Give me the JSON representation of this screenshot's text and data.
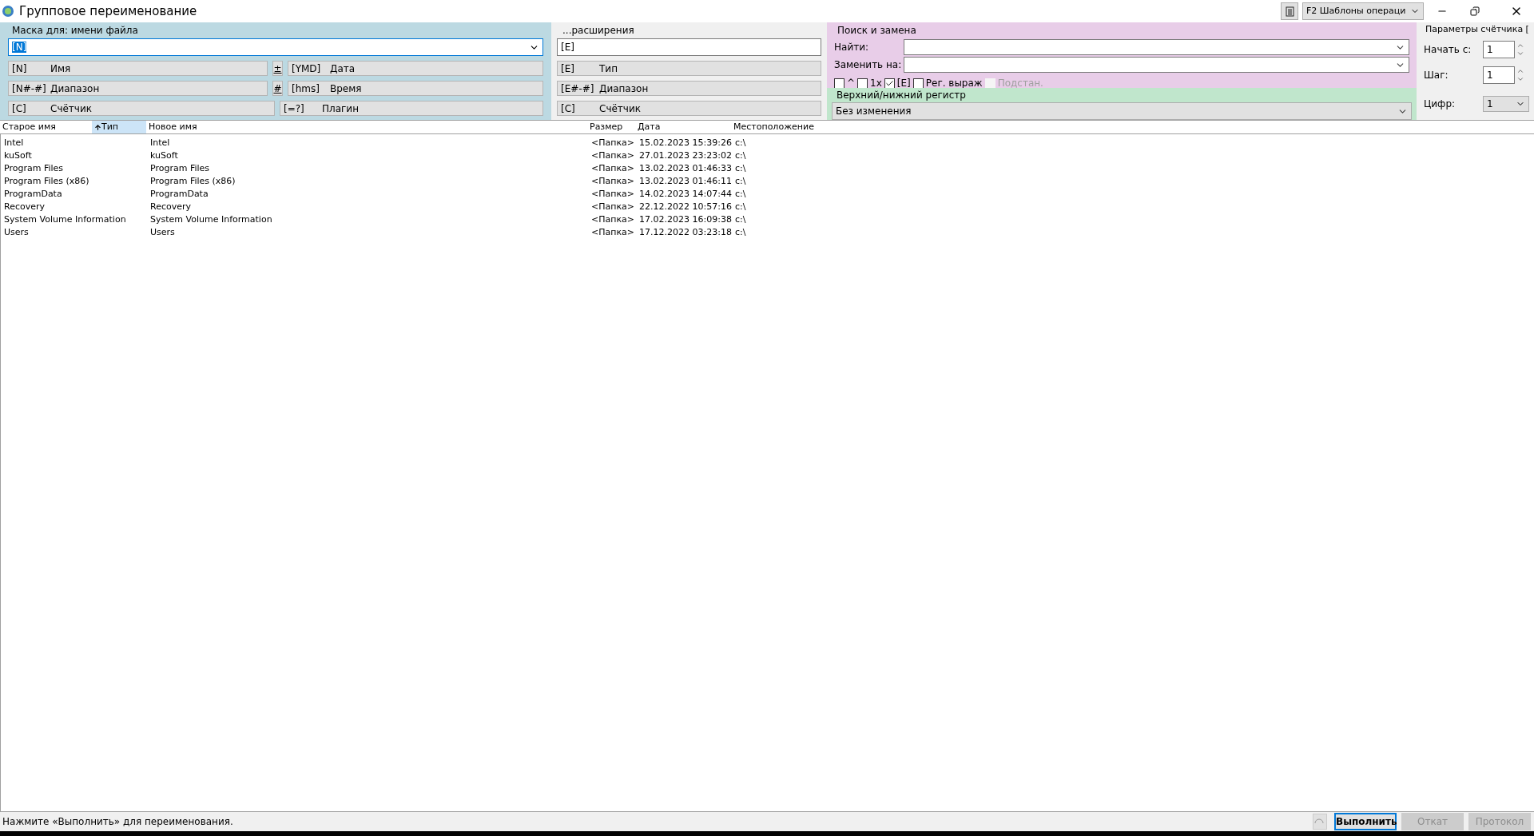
{
  "window": {
    "title": "Групповое переименование",
    "template_button": "F2 Шаблоны операци"
  },
  "mask": {
    "label": "Маска для: имени файла",
    "value": "[N]",
    "buttons": [
      {
        "code": "[N]",
        "label": "Имя",
        "side": "±",
        "code2": "[YMD]",
        "label2": "Дата"
      },
      {
        "code": "[N#-#]",
        "label": "Диапазон",
        "side": "#",
        "code2": "[hms]",
        "label2": "Время"
      },
      {
        "code": "[C]",
        "label": "Счётчик",
        "code2": "[=?]",
        "label2": "Плагин"
      }
    ]
  },
  "extension": {
    "label": "...расширения",
    "value": "[E]",
    "buttons": [
      {
        "code": "[E]",
        "label": "Тип"
      },
      {
        "code": "[E#-#]",
        "label": "Диапазон"
      },
      {
        "code": "[C]",
        "label": "Счётчик"
      }
    ]
  },
  "search_replace": {
    "label": "Поиск и замена",
    "find_label": "Найти:",
    "replace_label": "Заменить на:",
    "options": [
      {
        "label": "^",
        "checked": false,
        "disabled": false
      },
      {
        "label": "1x",
        "checked": false,
        "disabled": false
      },
      {
        "label": "[E]",
        "checked": true,
        "disabled": false
      },
      {
        "label": "Рег. выраж",
        "checked": false,
        "disabled": false
      },
      {
        "label": "Подстан.",
        "checked": false,
        "disabled": true
      }
    ]
  },
  "case": {
    "label": "Верхний/нижний регистр",
    "value": "Без изменения"
  },
  "counter": {
    "label": "Параметры счётчика [",
    "start_label": "Начать с:",
    "start": "1",
    "step_label": "Шаг:",
    "step": "1",
    "digits_label": "Цифр:",
    "digits": "1"
  },
  "table": {
    "columns": [
      {
        "label": "Старое имя",
        "sorted": false
      },
      {
        "label": "Тип",
        "sorted": true
      },
      {
        "label": "Новое имя",
        "sorted": false
      },
      {
        "label": "Размер",
        "sorted": false
      },
      {
        "label": "Дата",
        "sorted": false
      },
      {
        "label": "Местоположение",
        "sorted": false
      }
    ],
    "rows": [
      [
        "Intel",
        "",
        "Intel",
        "<Папка>",
        "15.02.2023 15:39:26",
        "c:\\"
      ],
      [
        "kuSoft",
        "",
        "kuSoft",
        "<Папка>",
        "27.01.2023 23:23:02",
        "c:\\"
      ],
      [
        "Program Files",
        "",
        "Program Files",
        "<Папка>",
        "13.02.2023 01:46:33",
        "c:\\"
      ],
      [
        "Program Files (x86)",
        "",
        "Program Files (x86)",
        "<Папка>",
        "13.02.2023 01:46:11",
        "c:\\"
      ],
      [
        "ProgramData",
        "",
        "ProgramData",
        "<Папка>",
        "14.02.2023 14:07:44",
        "c:\\"
      ],
      [
        "Recovery",
        "",
        "Recovery",
        "<Папка>",
        "22.12.2022 10:57:16",
        "c:\\"
      ],
      [
        "System Volume Information",
        "",
        "System Volume Information",
        "<Папка>",
        "17.02.2023 16:09:38",
        "c:\\"
      ],
      [
        "Users",
        "",
        "Users",
        "<Папка>",
        "17.12.2022 03:23:18",
        "c:\\"
      ]
    ]
  },
  "status_bar": {
    "message": "Нажмите «Выполнить» для переименования.",
    "buttons": [
      {
        "label": "Выполнить",
        "disabled": false,
        "default": true
      },
      {
        "label": "Откат",
        "disabled": true,
        "default": false
      },
      {
        "label": "Протокол",
        "disabled": true,
        "default": false
      }
    ]
  }
}
